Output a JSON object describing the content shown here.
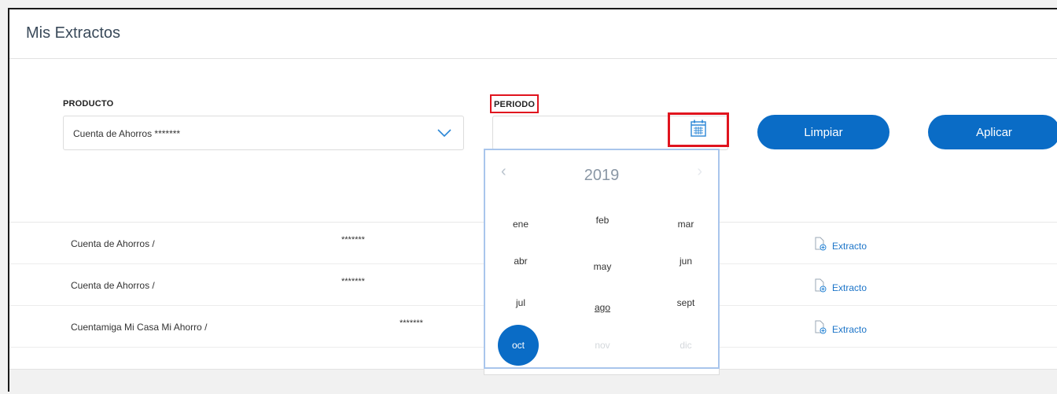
{
  "page": {
    "title": "Mis Extractos"
  },
  "filters": {
    "product_label": "PRODUCTO",
    "product_value": "Cuenta de Ahorros *******",
    "period_label": "PERIODO",
    "period_value": "",
    "clear_label": "Limpiar",
    "apply_label": "Aplicar"
  },
  "rows": [
    {
      "product": "Cuenta de Ahorros /",
      "masked": "*******",
      "action": "Extracto"
    },
    {
      "product": "Cuenta de Ahorros /",
      "masked": "*******",
      "action": "Extracto"
    },
    {
      "product": "Cuentamiga Mi Casa Mi Ahorro /",
      "masked": "*******",
      "action": "Extracto"
    }
  ],
  "datepicker": {
    "year": "2019",
    "prev": "‹",
    "next": "›",
    "months": [
      {
        "label": "ene",
        "state": "enabled"
      },
      {
        "label": "feb",
        "state": "enabled"
      },
      {
        "label": "mar",
        "state": "enabled"
      },
      {
        "label": "abr",
        "state": "enabled"
      },
      {
        "label": "may",
        "state": "enabled"
      },
      {
        "label": "jun",
        "state": "enabled"
      },
      {
        "label": "jul",
        "state": "enabled"
      },
      {
        "label": "ago",
        "state": "current"
      },
      {
        "label": "sept",
        "state": "enabled"
      },
      {
        "label": "oct",
        "state": "selected"
      },
      {
        "label": "nov",
        "state": "disabled"
      },
      {
        "label": "dic",
        "state": "disabled"
      }
    ]
  },
  "icons": {
    "chevron": "chevron-down-icon",
    "calendar": "calendar-icon",
    "document": "document-download-icon"
  },
  "colors": {
    "primary": "#0a6cc6",
    "highlight": "#e0141e",
    "link": "#1b74c8"
  }
}
